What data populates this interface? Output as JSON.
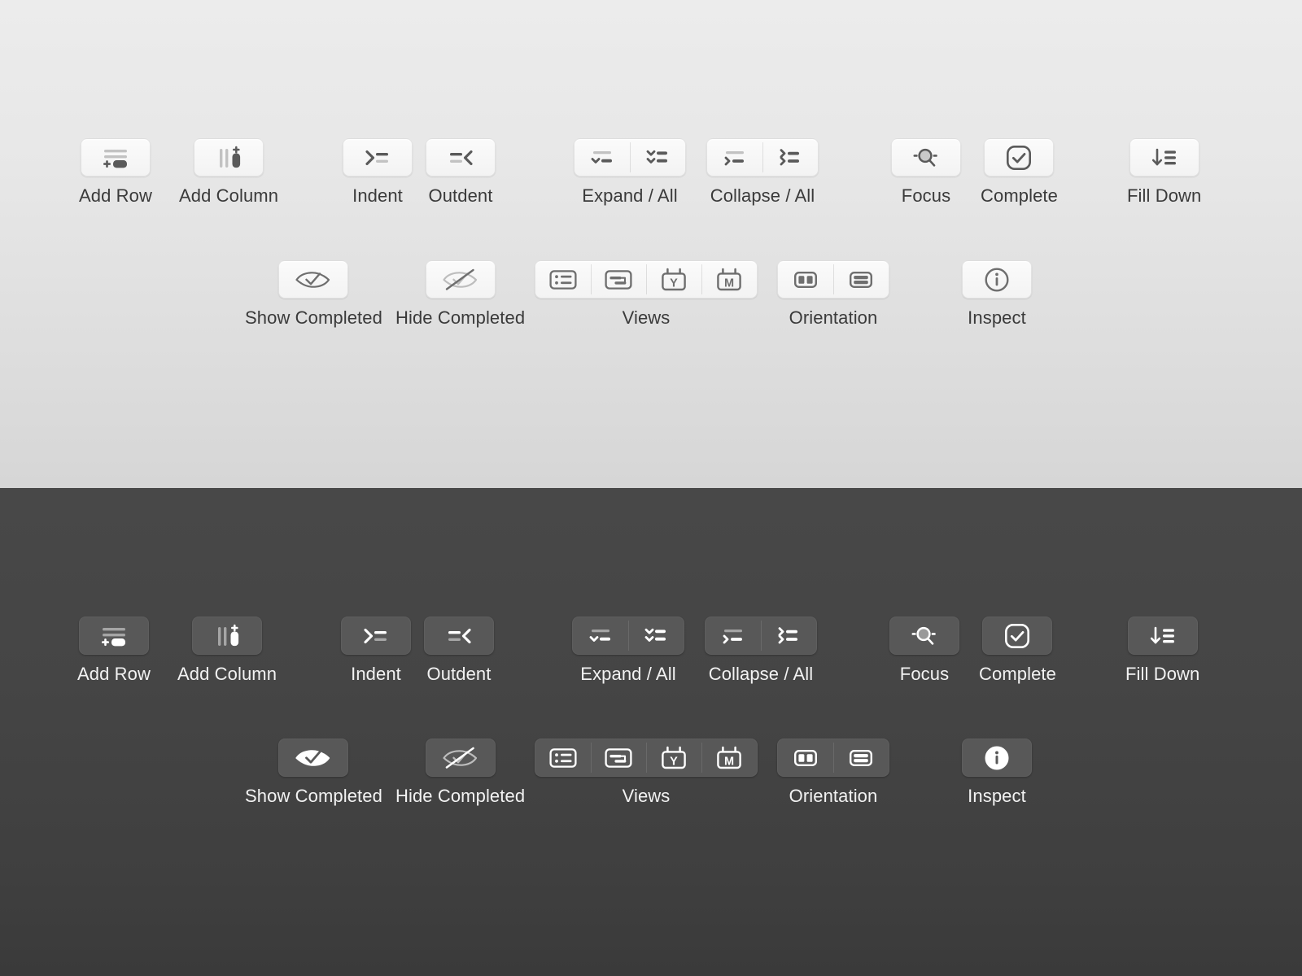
{
  "themes": [
    {
      "name": "light",
      "background_top": "#ececec",
      "background_bottom": "#d6d6d6",
      "button_fill": "#f7f7f7",
      "icon_color": "#6e6e6e",
      "label_color": "#3a3a3a"
    },
    {
      "name": "dark",
      "background_top": "#484848",
      "background_bottom": "#3a3a3a",
      "button_fill": "#585858",
      "icon_color": "#ffffff",
      "label_color": "#f2f2f2"
    }
  ],
  "toolbar": {
    "row1": [
      {
        "id": "add-row",
        "label": "Add Row",
        "icon": "add-row-icon",
        "type": "button"
      },
      {
        "id": "add-column",
        "label": "Add Column",
        "icon": "add-column-icon",
        "type": "button"
      },
      {
        "id": "indent",
        "label": "Indent",
        "icon": "indent-icon",
        "type": "button"
      },
      {
        "id": "outdent",
        "label": "Outdent",
        "icon": "outdent-icon",
        "type": "button"
      },
      {
        "id": "expand-all",
        "label": "Expand / All",
        "icon": "expand-icon",
        "type": "segmented",
        "segments": [
          "expand-icon",
          "expand-all-icon"
        ]
      },
      {
        "id": "collapse-all",
        "label": "Collapse / All",
        "icon": "collapse-icon",
        "type": "segmented",
        "segments": [
          "collapse-icon",
          "collapse-all-icon"
        ]
      },
      {
        "id": "focus",
        "label": "Focus",
        "icon": "focus-icon",
        "type": "button"
      },
      {
        "id": "complete",
        "label": "Complete",
        "icon": "complete-icon",
        "type": "button"
      },
      {
        "id": "fill-down",
        "label": "Fill Down",
        "icon": "fill-down-icon",
        "type": "button"
      }
    ],
    "row2": [
      {
        "id": "show-completed",
        "label": "Show Completed",
        "icon": "eye-check-icon",
        "type": "button"
      },
      {
        "id": "hide-completed",
        "label": "Hide Completed",
        "icon": "eye-slash-check-icon",
        "type": "button"
      },
      {
        "id": "views",
        "label": "Views",
        "type": "segmented",
        "segments": [
          "list-view-icon",
          "board-view-icon",
          "calendar-year-icon",
          "calendar-month-icon"
        ]
      },
      {
        "id": "orientation",
        "label": "Orientation",
        "type": "segmented",
        "segments": [
          "split-vertical-icon",
          "split-horizontal-icon"
        ]
      },
      {
        "id": "inspect",
        "label": "Inspect",
        "icon": "info-circle-icon",
        "type": "button"
      }
    ]
  },
  "calendar_glyphs": {
    "year": "Y",
    "month": "M"
  }
}
